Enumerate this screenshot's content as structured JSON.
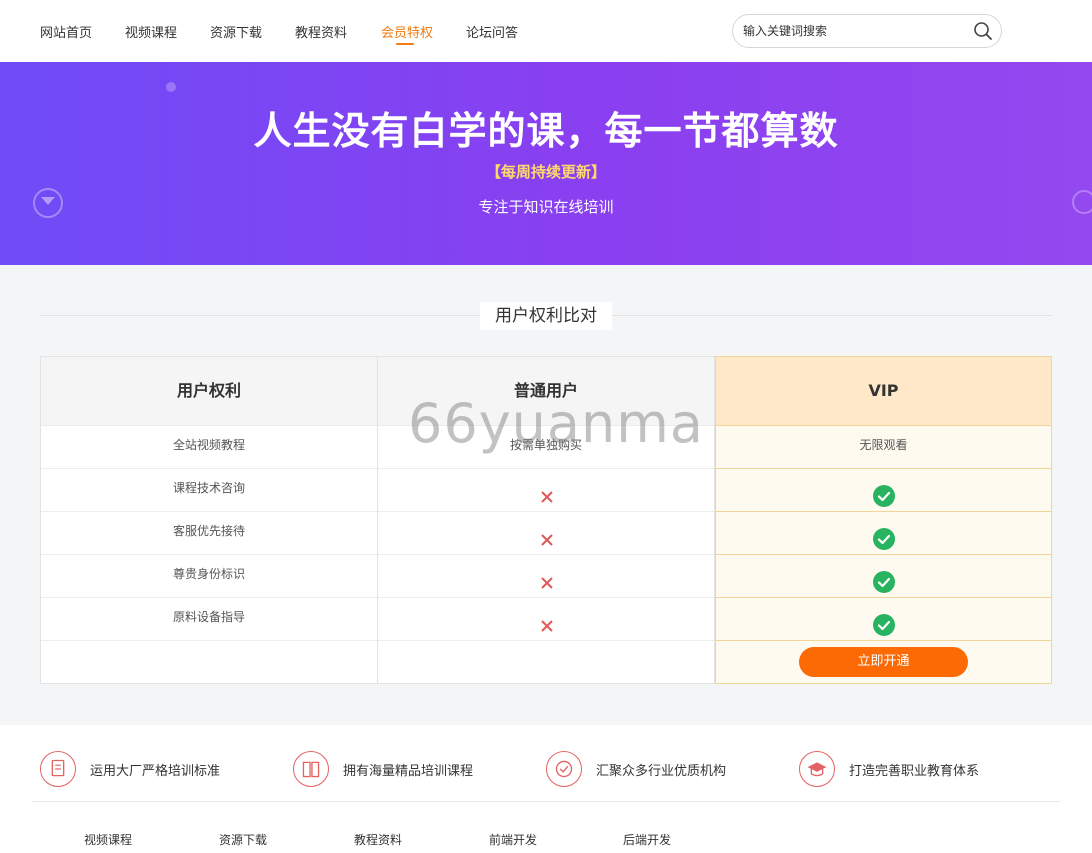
{
  "nav": {
    "items": [
      {
        "label": "网站首页",
        "active": false
      },
      {
        "label": "视频课程",
        "active": false
      },
      {
        "label": "资源下载",
        "active": false
      },
      {
        "label": "教程资料",
        "active": false
      },
      {
        "label": "会员特权",
        "active": true
      },
      {
        "label": "论坛问答",
        "active": false
      }
    ],
    "search_placeholder": "输入关键词搜索",
    "search_value": ""
  },
  "banner": {
    "title": "人生没有白学的课，每一节都算数",
    "tag": "【每周持续更新】",
    "subtitle": "专注于知识在线培训"
  },
  "section_title": "用户权利比对",
  "table": {
    "headers": [
      "用户权利",
      "普通用户",
      "VIP"
    ],
    "rows": [
      {
        "feature": "全站视频教程",
        "normal": "按需单独购买",
        "vip": "无限观看"
      },
      {
        "feature": "课程技术咨询",
        "normal": "no",
        "vip": "yes"
      },
      {
        "feature": "客服优先接待",
        "normal": "no",
        "vip": "yes"
      },
      {
        "feature": "尊贵身份标识",
        "normal": "no",
        "vip": "yes"
      },
      {
        "feature": "原料设备指导",
        "normal": "no",
        "vip": "yes"
      }
    ],
    "action_label": "立即开通"
  },
  "watermark": "66yuanma",
  "footer": {
    "features": [
      {
        "icon": "certificate-icon",
        "label": "运用大厂严格培训标准"
      },
      {
        "icon": "book-icon",
        "label": "拥有海量精品培训课程"
      },
      {
        "icon": "quality-badge-icon",
        "label": "汇聚众多行业优质机构"
      },
      {
        "icon": "graduation-cap-icon",
        "label": "打造完善职业教育体系"
      }
    ],
    "links": [
      "视频课程",
      "资源下载",
      "教程资料",
      "前端开发",
      "后端开发"
    ]
  },
  "colors": {
    "accent": "#f07c13",
    "banner_start": "#6f4cf7",
    "banner_end": "#9448ef",
    "vip_header": "#fee8c7",
    "check_green": "#27b35f",
    "cross_red": "#e05a5a",
    "button": "#fb6a05"
  }
}
